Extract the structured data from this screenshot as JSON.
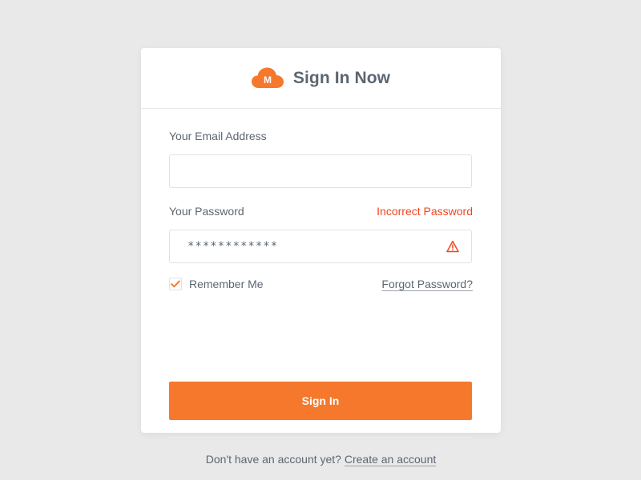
{
  "header": {
    "logo_letter": "M",
    "title": "Sign In Now",
    "logo_icon": "cloud-logo-icon"
  },
  "email": {
    "label": "Your Email Address",
    "value": "",
    "placeholder": ""
  },
  "password": {
    "label": "Your Password",
    "error": "Incorrect Password",
    "masked_value": "************",
    "warning_icon": "warning-triangle-icon"
  },
  "remember": {
    "label": "Remember Me",
    "checked": true,
    "check_icon": "checkmark-icon"
  },
  "forgot_link": "Forgot Password?",
  "signin_button": "Sign In",
  "footer": {
    "prompt": "Don't have an account yet?",
    "link": "Create an account"
  },
  "colors": {
    "accent": "#f5782d",
    "error": "#f0451f",
    "text": "#5c6670",
    "background": "#e9e9ea",
    "card": "#ffffff"
  }
}
